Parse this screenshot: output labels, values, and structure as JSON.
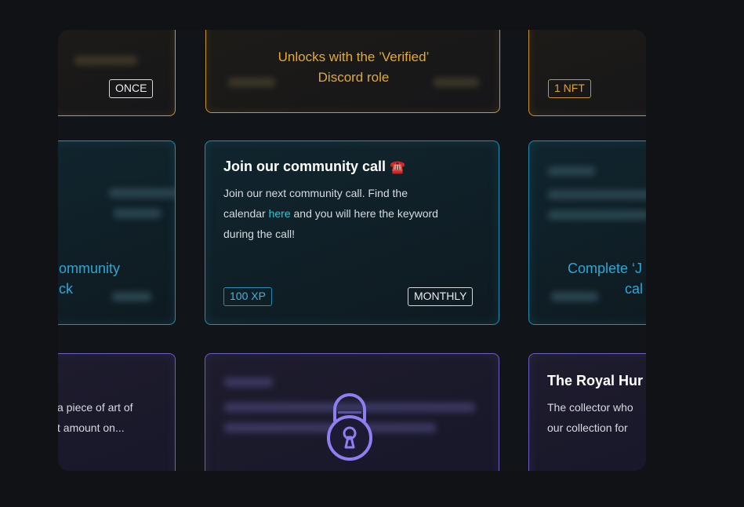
{
  "row1": {
    "left_badge": "ONCE",
    "center_text_line1": "Unlocks with the ’Verified’",
    "center_text_line2": "Discord role",
    "right_badge": "1 NFT"
  },
  "row2": {
    "left_text_line1": "ommunity",
    "left_text_line2": "ck",
    "center": {
      "title": "Join our community call",
      "title_emoji": "☎️",
      "desc_line1": "Join our next community call. Find the",
      "desc_line2_pre": "calendar ",
      "desc_link": "here",
      "desc_line2_post": " and you will here the keyword",
      "desc_line3": "during the call!",
      "xp_badge": "100 XP",
      "freq_badge": "MONTHLY"
    },
    "right_text_line1": "Complete ‘J",
    "right_text_line2": "cal"
  },
  "row3": {
    "left_desc_line1": "a piece of art of",
    "left_desc_line2": "t amount on...",
    "right_title": "The Royal Hur",
    "right_desc_line1": "The collector who",
    "right_desc_line2": "our collection for"
  },
  "colors": {
    "gold": "#c9962a",
    "cyan": "#1f8fb3",
    "purple": "#6b5fc0",
    "background": "#101216"
  },
  "icons": [
    "lock-icon",
    "unlock-icon"
  ]
}
